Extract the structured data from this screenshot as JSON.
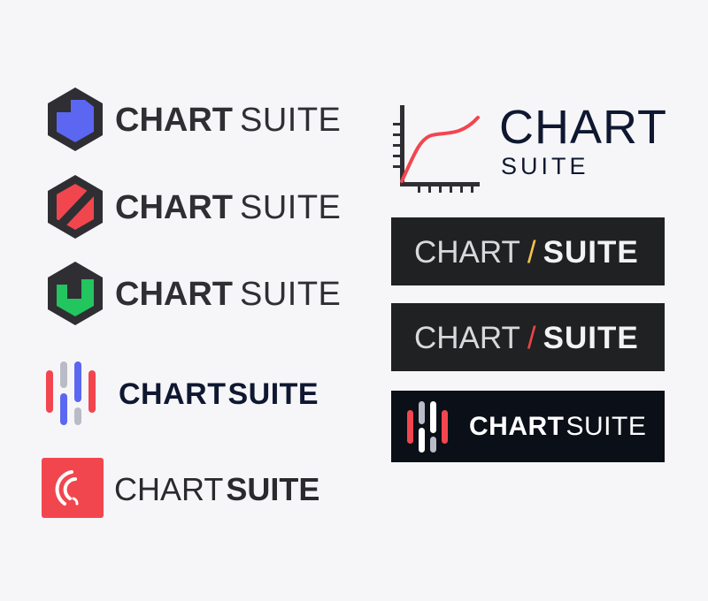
{
  "colors": {
    "background": "#f6f6f9",
    "hex_dark": "#2f2f33",
    "blue_accent": "#5b67f1",
    "red_accent": "#f2464f",
    "green_accent": "#22c55e",
    "grey_bar": "#b9bcc6",
    "navy_text": "#0f1830",
    "panel_dark_1": "#1f2123",
    "panel_dark_2": "#1f2123",
    "panel_dark_3": "#0b0f17",
    "yellow_slash": "#f3c24d",
    "red_slash": "#ef4444"
  },
  "logos": {
    "hex_blue": {
      "word1": "CHART",
      "word2": "SUITE"
    },
    "hex_red": {
      "word1": "CHART",
      "word2": "SUITE"
    },
    "hex_green": {
      "word1": "CHART",
      "word2": "SUITE"
    },
    "bars": {
      "word1": "CHART",
      "word2": "SUITE"
    },
    "red_square": {
      "word1": "CHART",
      "word2": "SUITE"
    },
    "curve": {
      "word1": "CHART",
      "word2": "SUITE"
    },
    "dark_yellow": {
      "word1": "CHART",
      "slash": "/",
      "word2": "SUITE"
    },
    "dark_red": {
      "word1": "CHART",
      "slash": "/",
      "word2": "SUITE"
    },
    "dark_bars": {
      "word1": "CHART",
      "word2": "SUITE"
    }
  }
}
